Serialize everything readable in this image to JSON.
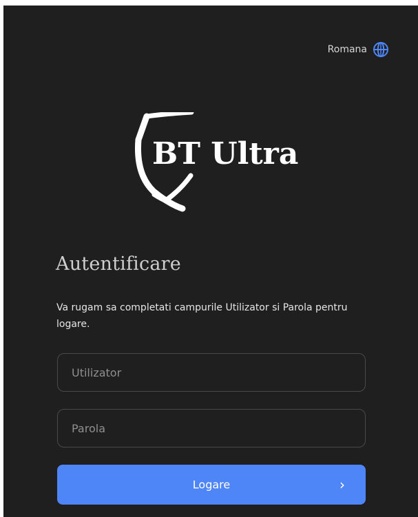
{
  "language": {
    "label": "Romana",
    "icon": "globe-icon",
    "icon_color": "#4f86f7"
  },
  "logo": {
    "text": "BT Ultra"
  },
  "login": {
    "title": "Autentificare",
    "description": "Va rugam sa completati campurile Utilizator si Parola pentru logare.",
    "username_placeholder": "Utilizator",
    "password_placeholder": "Parola",
    "submit_label": "Logare",
    "submit_icon": "chevron-right-icon"
  },
  "colors": {
    "background": "#1f1f1f",
    "accent": "#4f86f7",
    "field_border": "#4a4a4a"
  }
}
